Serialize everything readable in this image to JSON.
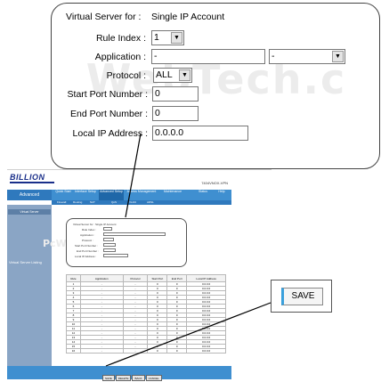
{
  "callout": {
    "watermark": "WebTech.c",
    "fields": {
      "virtual_server_label": "Virtual Server for :",
      "virtual_server_value": "Single IP Account",
      "rule_index_label": "Rule Index :",
      "rule_index_value": "1",
      "application_label": "Application :",
      "application_value1": "-",
      "application_value2": "-",
      "protocol_label": "Protocol :",
      "protocol_value": "ALL",
      "start_port_label": "Start Port Number :",
      "start_port_value": "0",
      "end_port_label": "End Port Number :",
      "end_port_value": "0",
      "local_ip_label": "Local IP Address :",
      "local_ip_value": "0.0.0.0"
    }
  },
  "router_page": {
    "logo": "BILLION",
    "model": "7404VNOX-VPN",
    "nav_left": "Advanced",
    "nav_items": [
      "Quick Start",
      "Interface Setup",
      "Advanced Setup",
      "Access Management",
      "Maintenance",
      "Status",
      "Help"
    ],
    "sub_nav": [
      "Firewall",
      "Routing",
      "NAT",
      "QoS",
      "VLAN",
      "ADSL"
    ],
    "sidebar_head": "Virtual Server",
    "sidebar_label": "Virtual Server Listing",
    "mini_watermark": "PcWebTech.com",
    "mini_form": [
      "Virtual Server for : Single IP Account",
      "Rule Index :",
      "Application :",
      "Protocol :",
      "Start Port Number :",
      "End Port Number :",
      "Local IP Address :"
    ],
    "table_headers": [
      "Rule",
      "Application",
      "Protocol",
      "Start Port",
      "End Port",
      "Local IP Address"
    ],
    "table_rows": [
      [
        "1",
        "-",
        "-",
        "0",
        "0",
        "0.0.0.0"
      ],
      [
        "2",
        "-",
        "-",
        "0",
        "0",
        "0.0.0.0"
      ],
      [
        "3",
        "-",
        "-",
        "0",
        "0",
        "0.0.0.0"
      ],
      [
        "4",
        "-",
        "-",
        "0",
        "0",
        "0.0.0.0"
      ],
      [
        "5",
        "-",
        "-",
        "0",
        "0",
        "0.0.0.0"
      ],
      [
        "6",
        "-",
        "-",
        "0",
        "0",
        "0.0.0.0"
      ],
      [
        "7",
        "-",
        "-",
        "0",
        "0",
        "0.0.0.0"
      ],
      [
        "8",
        "-",
        "-",
        "0",
        "0",
        "0.0.0.0"
      ],
      [
        "9",
        "-",
        "-",
        "0",
        "0",
        "0.0.0.0"
      ],
      [
        "10",
        "-",
        "-",
        "0",
        "0",
        "0.0.0.0"
      ],
      [
        "11",
        "-",
        "-",
        "0",
        "0",
        "0.0.0.0"
      ],
      [
        "12",
        "-",
        "-",
        "0",
        "0",
        "0.0.0.0"
      ],
      [
        "13",
        "-",
        "-",
        "0",
        "0",
        "0.0.0.0"
      ],
      [
        "14",
        "-",
        "-",
        "0",
        "0",
        "0.0.0.0"
      ],
      [
        "15",
        "-",
        "-",
        "0",
        "0",
        "0.0.0.0"
      ],
      [
        "16",
        "-",
        "-",
        "0",
        "0",
        "0.0.0.0"
      ]
    ],
    "buttons": [
      "SAVE",
      "DELETE",
      "BACK",
      "CANCEL"
    ]
  },
  "save_callout": {
    "label": "SAVE"
  },
  "colors": {
    "nav_blue": "#3f8fd0",
    "sidebar": "#8aa5c5",
    "logo": "#1a2f8a",
    "save_accent": "#3aa0dc"
  }
}
